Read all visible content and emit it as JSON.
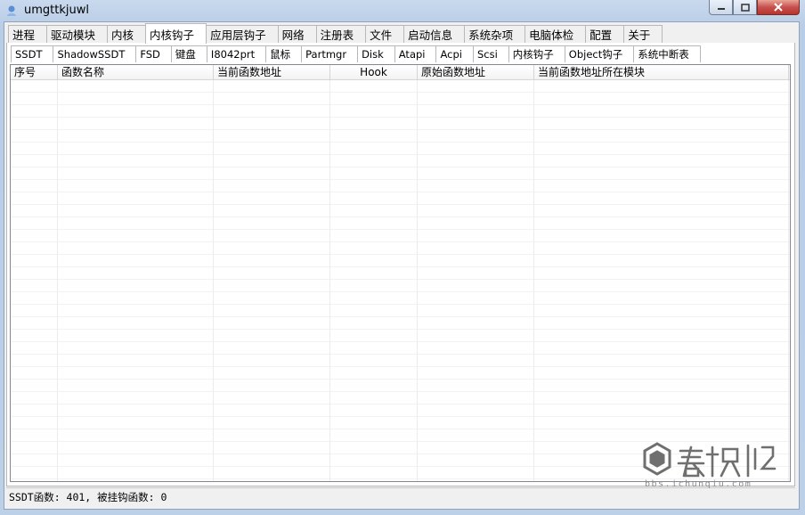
{
  "window": {
    "title": "umgttkjuwl"
  },
  "main_tabs": [
    "进程",
    "驱动模块",
    "内核",
    "内核钩子",
    "应用层钩子",
    "网络",
    "注册表",
    "文件",
    "启动信息",
    "系统杂项",
    "电脑体检",
    "配置",
    "关于"
  ],
  "main_tab_active": "内核钩子",
  "sub_tabs": [
    "SSDT",
    "ShadowSSDT",
    "FSD",
    "键盘",
    "I8042prt",
    "鼠标",
    "Partmgr",
    "Disk",
    "Atapi",
    "Acpi",
    "Scsi",
    "内核钩子",
    "Object钩子",
    "系统中断表"
  ],
  "sub_tab_active": "SSDT",
  "table": {
    "columns": [
      "序号",
      "函数名称",
      "当前函数地址",
      "Hook",
      "原始函数地址",
      "当前函数地址所在模块"
    ]
  },
  "status": {
    "text": "SSDT函数: 401, 被挂钩函数: 0"
  },
  "watermark": {
    "brand": "春秋社区",
    "url": "bbs.ichunqiu.com"
  }
}
